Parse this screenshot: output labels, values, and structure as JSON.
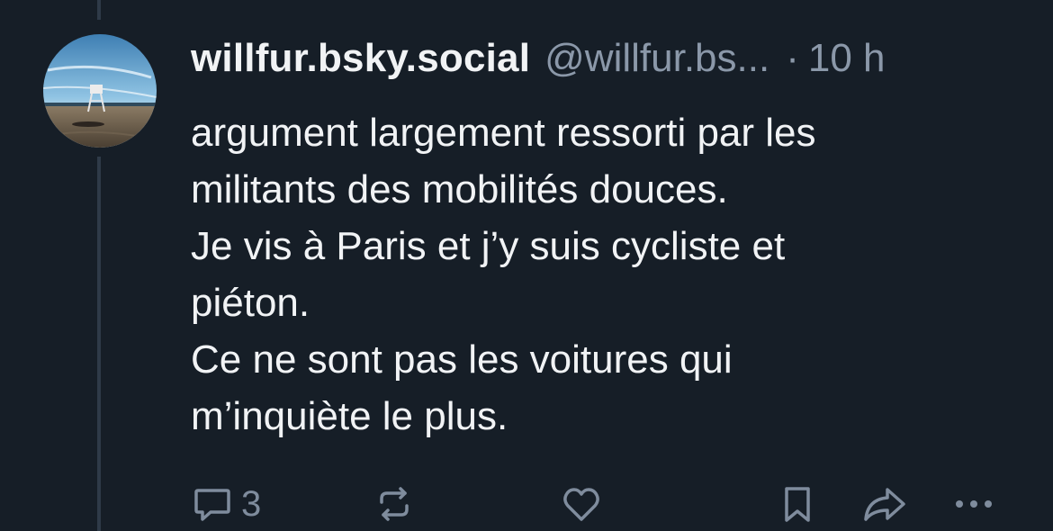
{
  "post": {
    "author_name": "willfur.bsky.social",
    "author_handle": "@willfur.bs...",
    "separator": "·",
    "timestamp": "10 h",
    "lines": [
      "argument largement ressorti par les",
      "militants des mobilités douces.",
      "Je vis à Paris et j’y suis cycliste et",
      "piéton.",
      "Ce ne sont pas les voitures qui",
      "m’inquiète le plus."
    ]
  },
  "actions": {
    "reply_count": "3",
    "reply_icon": "comment-icon",
    "repost_icon": "repost-icon",
    "like_icon": "heart-icon",
    "bookmark_icon": "bookmark-icon",
    "share_icon": "share-icon",
    "more_icon": "more-icon"
  },
  "colors": {
    "background": "#161e27",
    "text": "#f1f3f5",
    "muted": "#8b98a9",
    "icon": "#7f8c9d"
  }
}
